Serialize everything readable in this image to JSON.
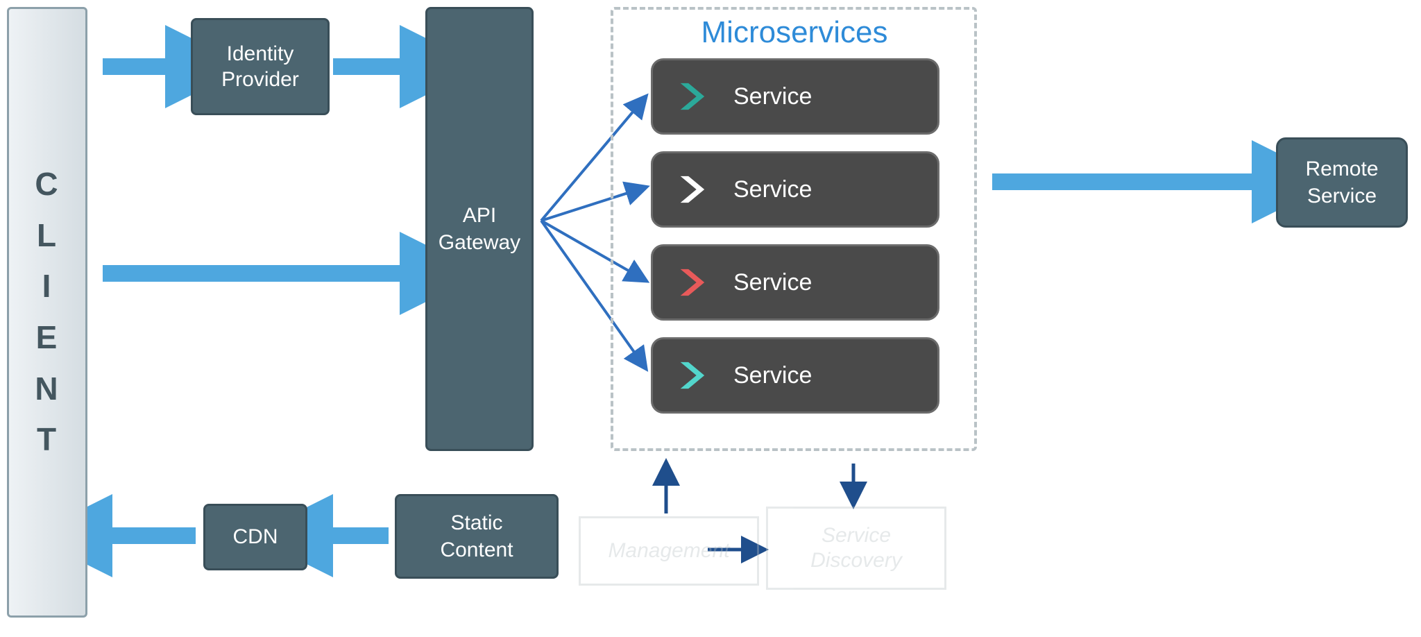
{
  "client": {
    "label_chars": [
      "C",
      "L",
      "I",
      "E",
      "N",
      "T"
    ]
  },
  "identity_provider": {
    "label": "Identity\nProvider"
  },
  "api_gateway": {
    "label": "API\nGateway"
  },
  "microservices": {
    "title": "Microservices",
    "services": [
      {
        "label": "Service",
        "chevron_color": "#2ba99a"
      },
      {
        "label": "Service",
        "chevron_color": "#ffffff"
      },
      {
        "label": "Service",
        "chevron_color": "#e85a5a"
      },
      {
        "label": "Service",
        "chevron_color": "#53d6cc"
      }
    ]
  },
  "remote_service": {
    "label": "Remote\nService"
  },
  "static_content": {
    "label": "Static\nContent"
  },
  "cdn": {
    "label": "CDN"
  },
  "management": {
    "label": "Management"
  },
  "service_discovery": {
    "label": "Service\nDiscovery"
  },
  "arrows": {
    "thick_color": "#4ea7df",
    "thin_color": "#2f6fbf",
    "nav_color": "#1f4e8c"
  }
}
